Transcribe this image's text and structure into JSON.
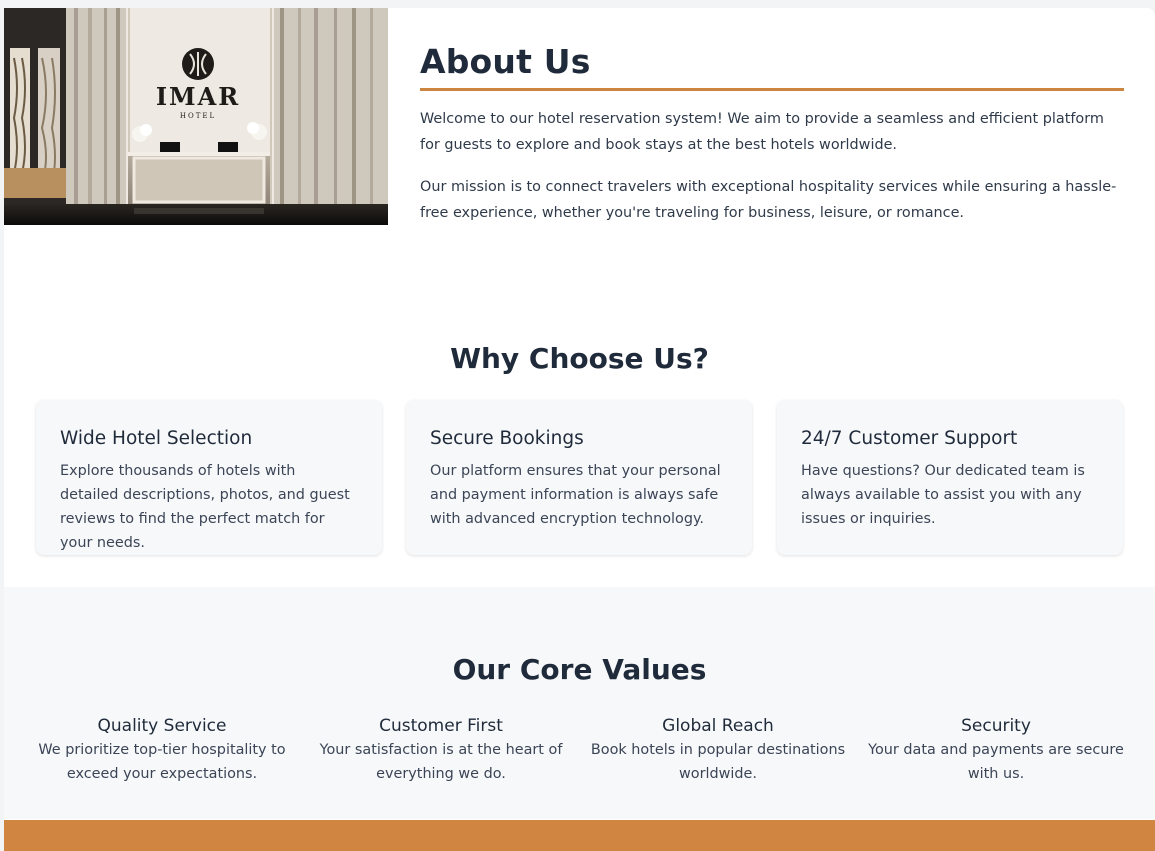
{
  "about": {
    "image_alt": "IMAR HOTEL lobby",
    "logo_text": "IMAR",
    "logo_sub": "HOTEL",
    "title": "About Us",
    "paragraphs": [
      "Welcome to our hotel reservation system! We aim to provide a seamless and efficient platform for guests to explore and book stays at the best hotels worldwide.",
      "Our mission is to connect travelers with exceptional hospitality services while ensuring a hassle-free experience, whether you're traveling for business, leisure, or romance."
    ]
  },
  "why": {
    "title": "Why Choose Us?",
    "cards": [
      {
        "title": "Wide Hotel Selection",
        "text": "Explore thousands of hotels with detailed descriptions, photos, and guest reviews to find the perfect match for your needs."
      },
      {
        "title": "Secure Bookings",
        "text": "Our platform ensures that your personal and payment information is always safe with advanced encryption technology."
      },
      {
        "title": "24/7 Customer Support",
        "text": "Have questions? Our dedicated team is always available to assist you with any issues or inquiries."
      }
    ]
  },
  "core": {
    "title": "Our Core Values",
    "values": [
      {
        "title": "Quality Service",
        "text": "We prioritize top-tier hospitality to exceed your expectations."
      },
      {
        "title": "Customer First",
        "text": "Your satisfaction is at the heart of everything we do."
      },
      {
        "title": "Global Reach",
        "text": "Book hotels in popular destinations worldwide."
      },
      {
        "title": "Security",
        "text": "Your data and payments are secure with us."
      }
    ]
  },
  "colors": {
    "accent": "#cc8540",
    "heading": "#1f2a3a",
    "card_bg": "#f7f8fa"
  }
}
